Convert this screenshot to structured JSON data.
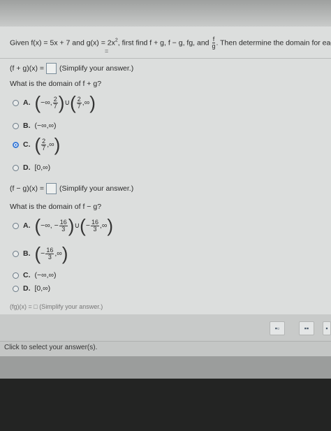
{
  "question": {
    "prefix": "Given f(x) = 5x + 7 and g(x) = 2x",
    "exponent": "2",
    "middle": ", first find f + g, f − g, fg, and",
    "frac_num": "f",
    "frac_den": "g",
    "suffix": ". Then determine the domain for eac",
    "mark": "="
  },
  "part1": {
    "label": "(f + g)(x) =",
    "hint": "(Simplify your answer.)",
    "domain_q": "What is the domain of f + g?",
    "options": [
      {
        "letter": "A.",
        "left": "−∞,",
        "n1": "2",
        "d1": "7",
        "union": "∪",
        "n2": "2",
        "d2": "7",
        "right": ",∞"
      },
      {
        "letter": "B.",
        "text": "(−∞,∞)"
      },
      {
        "letter": "C.",
        "n1": "2",
        "d1": "7",
        "right": ",∞"
      },
      {
        "letter": "D.",
        "text": "[0,∞)"
      }
    ]
  },
  "part2": {
    "label": "(f − g)(x) =",
    "hint": "(Simplify your answer.)",
    "domain_q": "What is the domain of f − g?",
    "options": [
      {
        "letter": "A.",
        "left": "−∞, −",
        "n1": "16",
        "d1": "3",
        "union": "∪",
        "mid": "−",
        "n2": "16",
        "d2": "3",
        "right": ",∞"
      },
      {
        "letter": "B.",
        "left": "−",
        "n1": "16",
        "d1": "3",
        "right": ",∞"
      },
      {
        "letter": "C.",
        "text": "(−∞,∞)"
      },
      {
        "letter": "D.",
        "text": "[0,∞)"
      }
    ]
  },
  "cut_text": "(fg)(x) = □ (Simplify your answer.)",
  "toolbar": {
    "btn1": "▪▫",
    "btn2": "▪▪",
    "btn3": "▪"
  },
  "status": "Click to select your answer(s)."
}
